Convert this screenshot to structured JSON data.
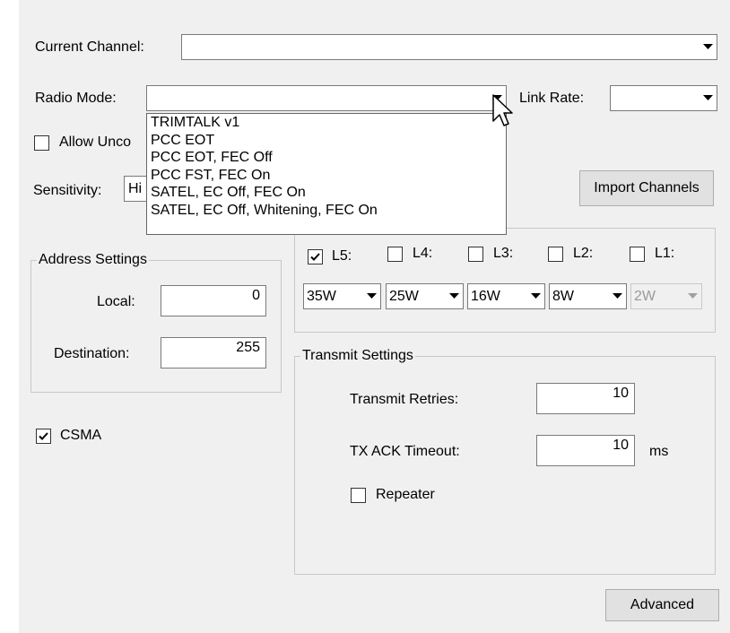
{
  "current_channel": {
    "label": "Current Channel:",
    "value": ""
  },
  "radio_mode": {
    "label": "Radio Mode:",
    "value": "",
    "options": [
      "TRIMTALK v1",
      "PCC EOT",
      "PCC EOT, FEC Off",
      "PCC FST, FEC On",
      "SATEL, EC Off, FEC On",
      "SATEL, EC Off, Whitening, FEC On"
    ]
  },
  "link_rate": {
    "label": "Link Rate:",
    "value": ""
  },
  "allow_unconfirmed": {
    "label_visible": "Allow Unco",
    "checked": false
  },
  "sensitivity": {
    "label": "Sensitivity:",
    "value_visible": "Hi"
  },
  "import_channels_label": "Import Channels",
  "power_levels": {
    "checkboxes": [
      {
        "label": "L5:",
        "checked": true
      },
      {
        "label": "L4:",
        "checked": false
      },
      {
        "label": "L3:",
        "checked": false
      },
      {
        "label": "L2:",
        "checked": false
      },
      {
        "label": "L1:",
        "checked": false
      }
    ],
    "selects": [
      {
        "value": "35W",
        "enabled": true
      },
      {
        "value": "25W",
        "enabled": true
      },
      {
        "value": "16W",
        "enabled": true
      },
      {
        "value": "8W",
        "enabled": true
      },
      {
        "value": "2W",
        "enabled": false
      }
    ]
  },
  "address_settings": {
    "title": "Address Settings",
    "local_label": "Local:",
    "local_value": "0",
    "destination_label": "Destination:",
    "destination_value": "255"
  },
  "csma": {
    "label": "CSMA",
    "checked": true
  },
  "transmit_settings": {
    "title": "Transmit Settings",
    "retries_label": "Transmit Retries:",
    "retries_value": "10",
    "ack_timeout_label": "TX ACK Timeout:",
    "ack_timeout_value": "10",
    "ack_timeout_unit": "ms",
    "repeater_label": "Repeater",
    "repeater_checked": false
  },
  "advanced_label": "Advanced"
}
